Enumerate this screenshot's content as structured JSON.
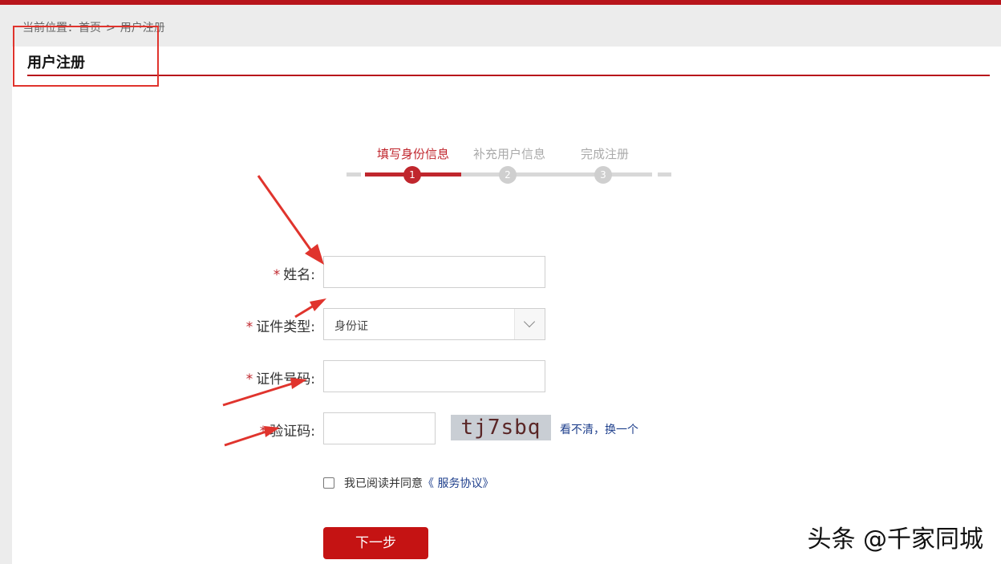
{
  "breadcrumb": {
    "prefix": "当前位置：",
    "home": "首页",
    "separator": ">",
    "current": "用户注册"
  },
  "page_title": "用户注册",
  "steps": [
    {
      "label": "填写身份信息",
      "number": "1",
      "state": "active"
    },
    {
      "label": "补充用户信息",
      "number": "2",
      "state": "inactive"
    },
    {
      "label": "完成注册",
      "number": "3",
      "state": "inactive"
    }
  ],
  "form": {
    "required_mark": "*",
    "name_label": "姓名:",
    "name_value": "",
    "id_type_label": "证件类型:",
    "id_type_value": "身份证",
    "id_number_label": "证件号码:",
    "id_number_value": "",
    "captcha_label": "验证码:",
    "captcha_value": "",
    "captcha_text": "tj7sbq",
    "refresh_link": "看不清，换一个",
    "agree_text": "我已阅读并同意",
    "agree_link": "《 服务协议》",
    "next_button": "下一步"
  },
  "watermark": "头条 @千家同城",
  "colors": {
    "brand_red": "#c0262d",
    "button_red": "#c51313",
    "link_blue": "#1e3f8c",
    "annotation_red": "#e0342d"
  }
}
